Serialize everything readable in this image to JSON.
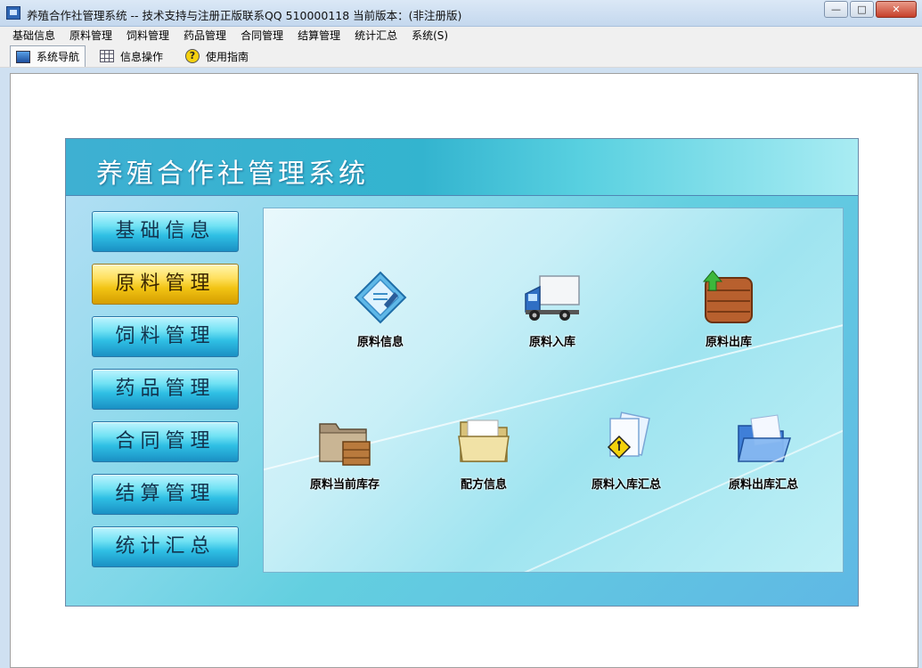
{
  "window": {
    "title": "养殖合作社管理系统 -- 技术支持与注册正版联系QQ 510000118   当前版本：(非注册版)",
    "buttons": {
      "minimize": "—",
      "maximize": "□",
      "close": "✕"
    }
  },
  "menubar": {
    "items": [
      "基础信息",
      "原料管理",
      "饲料管理",
      "药品管理",
      "合同管理",
      "结算管理",
      "统计汇总",
      "系统(S)"
    ]
  },
  "toolbar": {
    "tabs": [
      {
        "label": "系统导航",
        "icon": "monitor-icon",
        "active": true
      },
      {
        "label": "信息操作",
        "icon": "grid-icon"
      },
      {
        "label": "使用指南",
        "icon": "help-icon"
      }
    ]
  },
  "panel": {
    "title": "养殖合作社管理系统",
    "side_buttons": [
      "基础信息",
      "原料管理",
      "饲料管理",
      "药品管理",
      "合同管理",
      "结算管理",
      "统计汇总"
    ],
    "active_side_button": "原料管理",
    "tiles": [
      {
        "label": "原料信息",
        "icon": "document-edit-icon"
      },
      {
        "label": "原料入库",
        "icon": "truck-icon"
      },
      {
        "label": "原料出库",
        "icon": "crate-export-icon"
      },
      {
        "label": "原料当前库存",
        "icon": "folder-box-icon"
      },
      {
        "label": "配方信息",
        "icon": "folder-icon"
      },
      {
        "label": "原料入库汇总",
        "icon": "document-sign-icon"
      },
      {
        "label": "原料出库汇总",
        "icon": "blue-folder-icon"
      }
    ]
  },
  "colors": {
    "active_button": "#f2c414",
    "button": "#2fbfe4",
    "panel_header": "#33b4cf"
  }
}
